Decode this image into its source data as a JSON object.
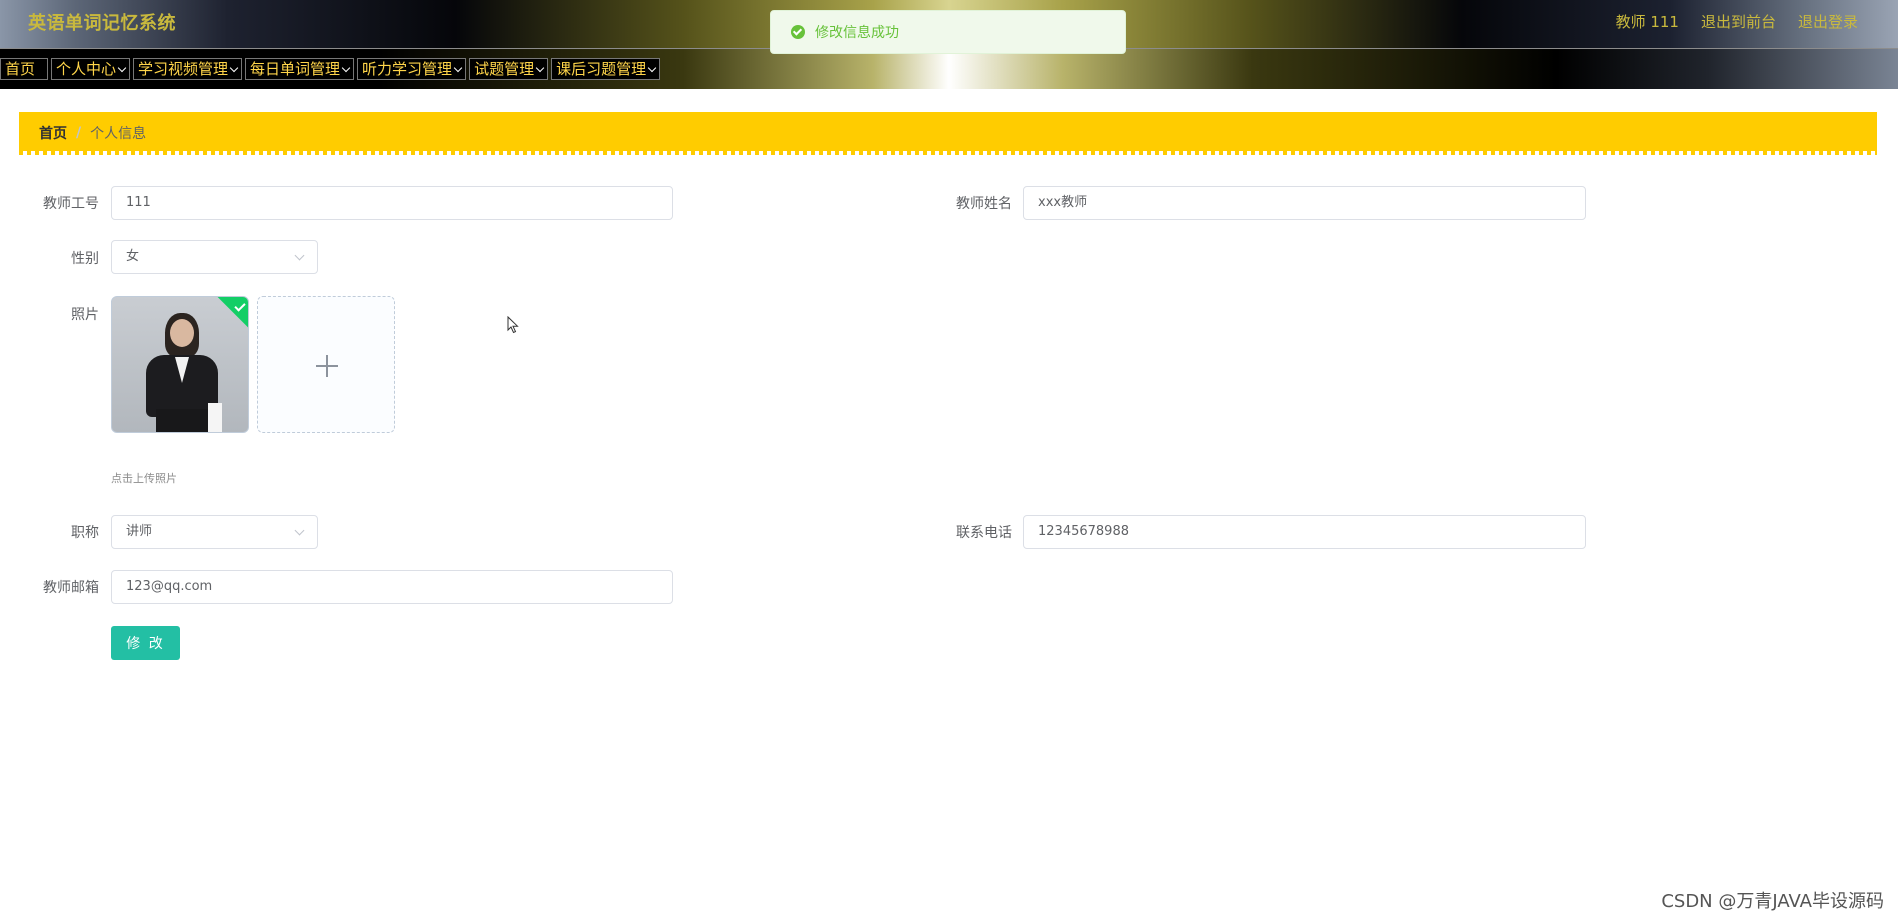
{
  "header": {
    "title": "英语单词记忆系统",
    "user": "教师 111",
    "to_front": "退出到前台",
    "logout": "退出登录"
  },
  "nav": {
    "home": "首页",
    "items": [
      "个人中心",
      "学习视频管理",
      "每日单词管理",
      "听力学习管理",
      "试题管理",
      "课后习题管理"
    ]
  },
  "toast": {
    "message": "修改信息成功",
    "icon": "success-check-icon",
    "color": "#67c23a"
  },
  "breadcrumb": {
    "home": "首页",
    "separator": "/",
    "current": "个人信息"
  },
  "form": {
    "teacher_id": {
      "label": "教师工号",
      "value": "111"
    },
    "teacher_name": {
      "label": "教师姓名",
      "value": "xxx教师"
    },
    "gender": {
      "label": "性别",
      "value": "女"
    },
    "photo": {
      "label": "照片",
      "hint": "点击上传照片"
    },
    "title_rank": {
      "label": "职称",
      "value": "讲师"
    },
    "phone": {
      "label": "联系电话",
      "value": "12345678988"
    },
    "email": {
      "label": "教师邮箱",
      "value": "123@qq.com"
    },
    "submit": "修 改"
  },
  "colors": {
    "accent": "#ffcc00",
    "button": "#23bfa4",
    "menu_text": "#ffd54a",
    "title_text": "#c9b93d"
  },
  "watermark": "CSDN @万青JAVA毕设源码"
}
